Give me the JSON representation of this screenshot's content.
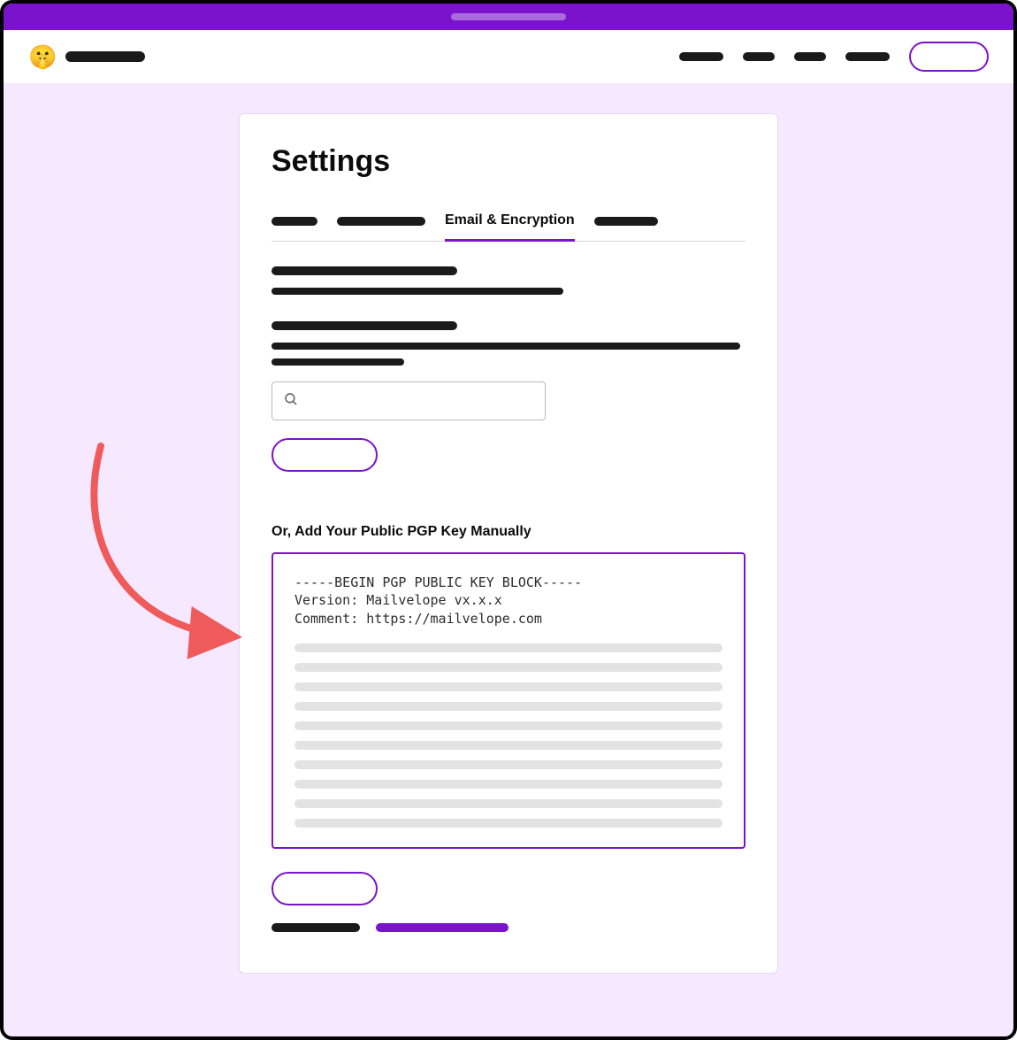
{
  "brand": {
    "emoji": "🤫"
  },
  "card": {
    "title": "Settings",
    "tabs": {
      "active_label": "Email & Encryption"
    },
    "manual_heading": "Or, Add Your Public PGP Key Manually",
    "pgp_preview": "-----BEGIN PGP PUBLIC KEY BLOCK-----\nVersion: Mailvelope vx.x.x\nComment: https://mailvelope.com"
  }
}
